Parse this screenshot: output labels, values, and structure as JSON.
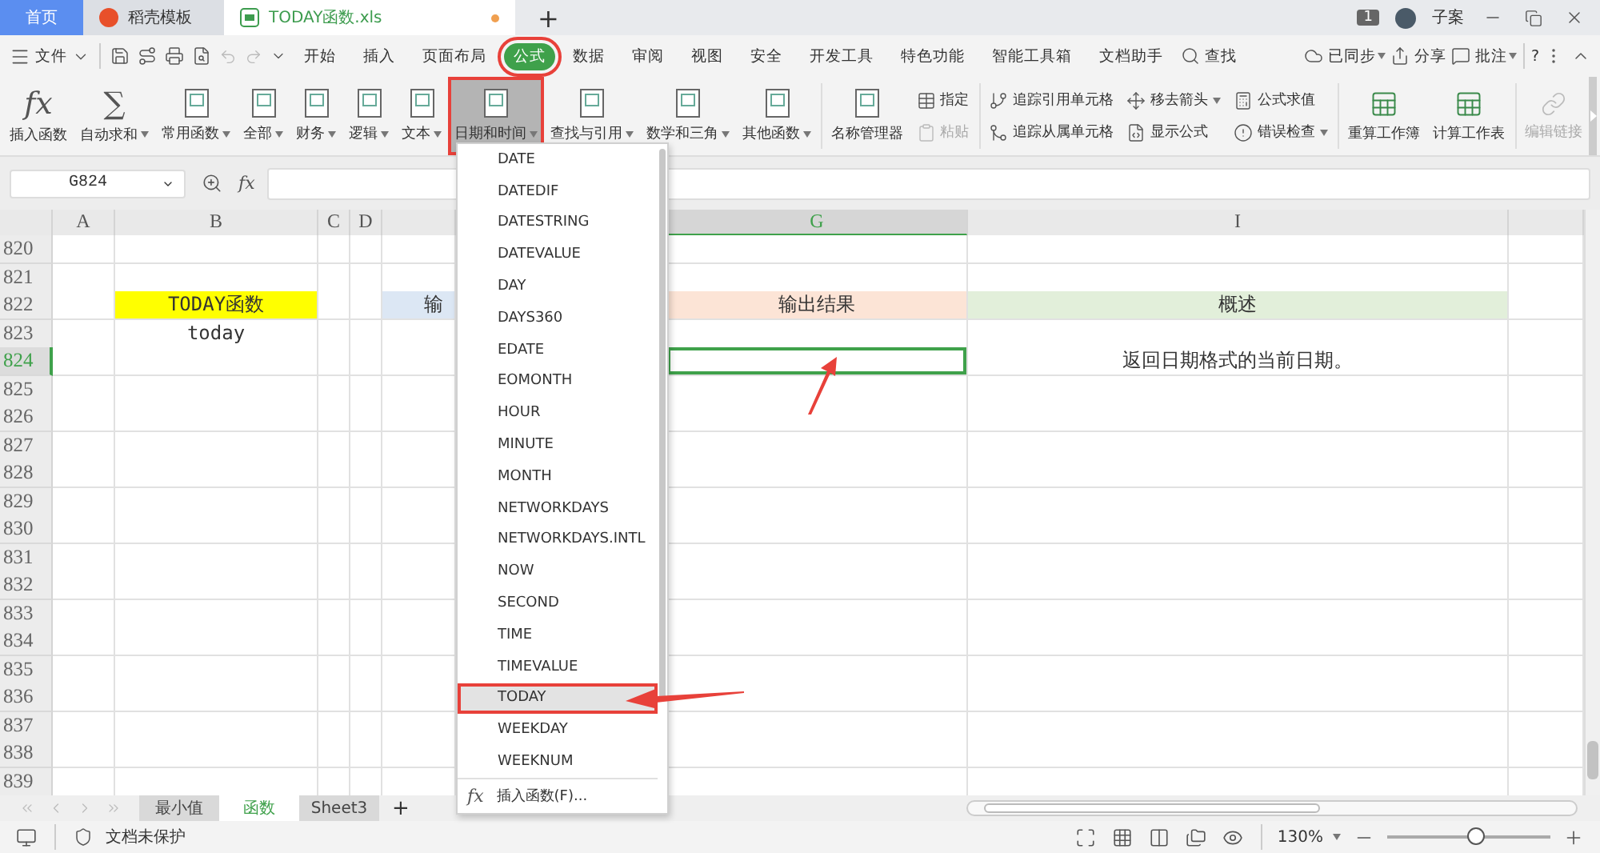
{
  "title_tabs": [
    {
      "label": "首页",
      "kind": "home",
      "selected": false
    },
    {
      "label": "稻壳模板",
      "kind": "docer",
      "selected": false
    },
    {
      "label": "TODAY函数.xls",
      "kind": "sheet",
      "selected": true,
      "modified": true
    }
  ],
  "new_tab": "+",
  "account": {
    "badge": "1",
    "user": "子案"
  },
  "menu": {
    "file": "文件",
    "tabs": [
      {
        "label": "开始",
        "selected": false,
        "highlighted": false
      },
      {
        "label": "插入",
        "selected": false,
        "highlighted": false
      },
      {
        "label": "页面布局",
        "selected": false,
        "highlighted": false
      },
      {
        "label": "公式",
        "selected": true,
        "highlighted": true
      },
      {
        "label": "数据",
        "selected": false,
        "highlighted": false
      },
      {
        "label": "审阅",
        "selected": false,
        "highlighted": false
      },
      {
        "label": "视图",
        "selected": false,
        "highlighted": false
      },
      {
        "label": "安全",
        "selected": false,
        "highlighted": false
      },
      {
        "label": "开发工具",
        "selected": false,
        "highlighted": false
      },
      {
        "label": "特色功能",
        "selected": false,
        "highlighted": false
      },
      {
        "label": "智能工具箱",
        "selected": false,
        "highlighted": false
      },
      {
        "label": "文档助手",
        "selected": false,
        "highlighted": false
      }
    ],
    "search": "查找",
    "sync": "已同步",
    "share": "分享",
    "comment": "批注",
    "help": "?"
  },
  "ribbon": {
    "functions": [
      {
        "label": "插入函数",
        "kind": "glyph",
        "glyph": "fx",
        "dropdown": false,
        "selected": false,
        "highlighted": false
      },
      {
        "label": "自动求和",
        "kind": "glyph",
        "glyph": "∑",
        "dropdown": true,
        "selected": false,
        "highlighted": false
      },
      {
        "label": "常用函数",
        "kind": "book",
        "dropdown": true,
        "selected": false,
        "highlighted": false
      },
      {
        "label": "全部",
        "kind": "book",
        "dropdown": true,
        "selected": false,
        "highlighted": false
      },
      {
        "label": "财务",
        "kind": "book",
        "dropdown": true,
        "selected": false,
        "highlighted": false
      },
      {
        "label": "逻辑",
        "kind": "book",
        "dropdown": true,
        "selected": false,
        "highlighted": false
      },
      {
        "label": "文本",
        "kind": "book",
        "dropdown": true,
        "selected": false,
        "highlighted": false
      },
      {
        "label": "日期和时间",
        "kind": "book",
        "dropdown": true,
        "selected": true,
        "highlighted": true
      },
      {
        "label": "查找与引用",
        "kind": "book",
        "dropdown": true,
        "selected": false,
        "highlighted": false
      },
      {
        "label": "数学和三角",
        "kind": "book",
        "dropdown": true,
        "selected": false,
        "highlighted": false
      },
      {
        "label": "其他函数",
        "kind": "book",
        "dropdown": true,
        "selected": false,
        "highlighted": false
      }
    ],
    "name_manager": "名称管理器",
    "tool_columns": [
      [
        {
          "label": "指定",
          "dropdown": false,
          "disabled": false
        },
        {
          "label": "粘贴",
          "dropdown": false,
          "disabled": true
        }
      ],
      [
        {
          "label": "追踪引用单元格",
          "dropdown": false,
          "disabled": false
        },
        {
          "label": "追踪从属单元格",
          "dropdown": false,
          "disabled": false
        }
      ],
      [
        {
          "label": "移去箭头",
          "dropdown": true,
          "disabled": false
        },
        {
          "label": "显示公式",
          "dropdown": false,
          "disabled": false
        }
      ],
      [
        {
          "label": "公式求值",
          "dropdown": false,
          "disabled": false
        },
        {
          "label": "错误检查",
          "dropdown": true,
          "disabled": false
        }
      ]
    ],
    "calc": [
      "重算工作簿",
      "计算工作表"
    ],
    "edit_links": {
      "label": "编辑链接",
      "disabled": true
    }
  },
  "formula_bar": {
    "name_box": "G824",
    "fx": "fx"
  },
  "columns": [
    {
      "label": "A",
      "selected": false
    },
    {
      "label": "B",
      "selected": false
    },
    {
      "label": "C",
      "selected": false
    },
    {
      "label": "D",
      "selected": false
    },
    {
      "selected": false
    },
    {
      "label": "G",
      "selected": true
    },
    {
      "label": "I",
      "selected": false
    },
    {
      "selected": false
    }
  ],
  "rows": [
    {
      "number": "820",
      "selected": false
    },
    {
      "number": "821",
      "selected": false
    },
    {
      "number": "822",
      "selected": false,
      "cells": [
        null,
        {
          "text": "TODAY函数",
          "color": "#ffff00",
          "selected": false
        },
        null,
        null,
        {
          "text": "输",
          "color": "#dce7f4",
          "selected": false
        },
        {
          "text": "输出结果",
          "color": "#fce4d6",
          "selected": false
        },
        {
          "text": "概述",
          "color": "#e2efda",
          "selected": false
        },
        null
      ]
    },
    {
      "number": "823",
      "selected": false,
      "cells": [
        null,
        {
          "text": "today",
          "selected": false
        },
        null,
        null,
        null,
        null,
        null,
        null
      ]
    },
    {
      "number": "824",
      "selected": true,
      "cells": [
        null,
        null,
        null,
        null,
        null,
        {
          "selected": true
        },
        {
          "text": "返回日期格式的当前日期。",
          "selected": false
        },
        null
      ]
    },
    {
      "number": "825",
      "selected": false
    },
    {
      "number": "826",
      "selected": false
    },
    {
      "number": "827",
      "selected": false
    },
    {
      "number": "828",
      "selected": false
    },
    {
      "number": "829",
      "selected": false
    },
    {
      "number": "830",
      "selected": false
    },
    {
      "number": "831",
      "selected": false
    },
    {
      "number": "832",
      "selected": false
    },
    {
      "number": "833",
      "selected": false
    },
    {
      "number": "834",
      "selected": false
    },
    {
      "number": "835",
      "selected": false
    },
    {
      "number": "836",
      "selected": false
    },
    {
      "number": "837",
      "selected": false
    },
    {
      "number": "838",
      "selected": false
    },
    {
      "number": "839",
      "selected": false
    }
  ],
  "dropdown": {
    "items": [
      {
        "label": "DATE",
        "selected": false,
        "highlighted": false
      },
      {
        "label": "DATEDIF",
        "selected": false,
        "highlighted": false
      },
      {
        "label": "DATESTRING",
        "selected": false,
        "highlighted": false
      },
      {
        "label": "DATEVALUE",
        "selected": false,
        "highlighted": false
      },
      {
        "label": "DAY",
        "selected": false,
        "highlighted": false
      },
      {
        "label": "DAYS360",
        "selected": false,
        "highlighted": false
      },
      {
        "label": "EDATE",
        "selected": false,
        "highlighted": false
      },
      {
        "label": "EOMONTH",
        "selected": false,
        "highlighted": false
      },
      {
        "label": "HOUR",
        "selected": false,
        "highlighted": false
      },
      {
        "label": "MINUTE",
        "selected": false,
        "highlighted": false
      },
      {
        "label": "MONTH",
        "selected": false,
        "highlighted": false
      },
      {
        "label": "NETWORKDAYS",
        "selected": false,
        "highlighted": false
      },
      {
        "label": "NETWORKDAYS.INTL",
        "selected": false,
        "highlighted": false
      },
      {
        "label": "NOW",
        "selected": false,
        "highlighted": false
      },
      {
        "label": "SECOND",
        "selected": false,
        "highlighted": false
      },
      {
        "label": "TIME",
        "selected": false,
        "highlighted": false
      },
      {
        "label": "TIMEVALUE",
        "selected": false,
        "highlighted": false
      },
      {
        "label": "TODAY",
        "selected": true,
        "highlighted": true
      },
      {
        "label": "WEEKDAY",
        "selected": false,
        "highlighted": false
      },
      {
        "label": "WEEKNUM",
        "selected": false,
        "highlighted": false
      }
    ],
    "footer_icon": "fx",
    "footer": "插入函数(F)..."
  },
  "sheet_tabs": [
    {
      "label": "最小值",
      "selected": false
    },
    {
      "label": "函数",
      "selected": true
    },
    {
      "label": "Sheet3",
      "selected": false
    }
  ],
  "add_sheet": "+",
  "status_bar": {
    "protection": "文档未保护",
    "zoom": "130%",
    "zoom_slider": {
      "level": 0.54
    }
  }
}
